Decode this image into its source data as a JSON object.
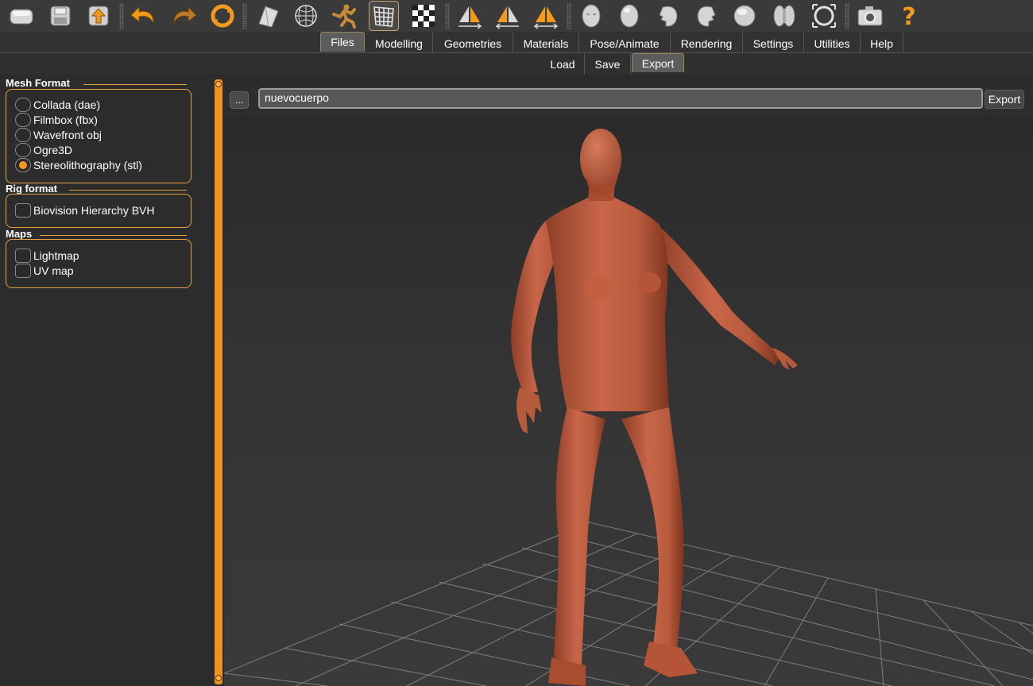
{
  "toolbar": {
    "icons": [
      "new-file-icon",
      "save-icon",
      "load-icon",
      "undo-icon",
      "redo-icon",
      "reset-icon",
      "smooth-icon",
      "wireframe-icon",
      "pose-icon",
      "grid-icon",
      "checker-icon",
      "symmetry-right-icon",
      "symmetry-left-icon",
      "symmetry-both-icon",
      "front-view-icon",
      "back-view-icon",
      "left-view-icon",
      "right-view-icon",
      "top-view-icon",
      "bottom-view-icon",
      "reset-camera-icon",
      "screenshot-icon",
      "help-icon"
    ]
  },
  "menu": {
    "tabs": [
      "Files",
      "Modelling",
      "Geometries",
      "Materials",
      "Pose/Animate",
      "Rendering",
      "Settings",
      "Utilities",
      "Help"
    ],
    "active": "Files"
  },
  "submenu": {
    "tabs": [
      "Load",
      "Save",
      "Export"
    ],
    "active": "Export"
  },
  "left": {
    "mesh_format": {
      "title": "Mesh Format",
      "options": [
        "Collada (dae)",
        "Filmbox (fbx)",
        "Wavefront obj",
        "Ogre3D",
        "Stereolithography (stl)"
      ],
      "selected": "Stereolithography (stl)"
    },
    "rig_format": {
      "title": "Rig format",
      "options": [
        "Biovision Hierarchy BVH"
      ]
    },
    "maps": {
      "title": "Maps",
      "options": [
        "Lightmap",
        "UV map"
      ]
    }
  },
  "filebar": {
    "browse_label": "...",
    "filename": "nuevocuerpo",
    "export_label": "Export"
  },
  "colors": {
    "accent": "#f29a1e",
    "model_skin": "#c0603f",
    "background": "#2b2b2b"
  }
}
